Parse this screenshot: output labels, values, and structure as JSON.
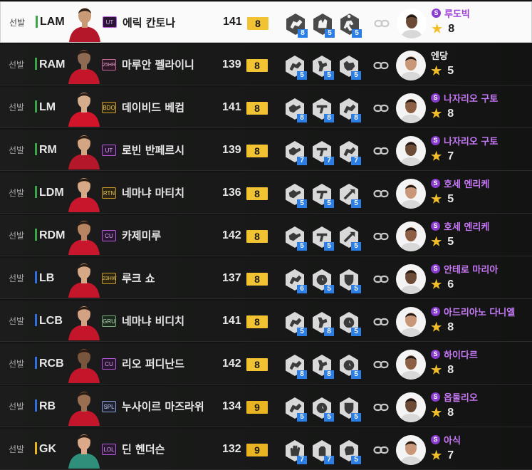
{
  "rows": [
    {
      "starter": "선발",
      "pos": "LAM",
      "pos_color": "#3aa64a",
      "badge": "UT",
      "badge_style": "",
      "name": "에릭 칸토나",
      "ovr": "141",
      "level": "8",
      "skills": [
        {
          "icon": "running-boot-icon",
          "v": "8"
        },
        {
          "icon": "hand-ball-icon",
          "v": "5"
        },
        {
          "icon": "player-run-icon",
          "v": "5"
        }
      ],
      "coach_special": true,
      "coach_name": "루도빅",
      "coach_star": "8",
      "selected": true,
      "kit": "#b5172a",
      "skin": "#c89a76"
    },
    {
      "starter": "선발",
      "pos": "RAM",
      "pos_color": "#3aa64a",
      "badge": "25HR",
      "badge_style": "pinkish",
      "name": "마루안 펠라이니",
      "ovr": "139",
      "level": "8",
      "skills": [
        {
          "icon": "running-boot-icon",
          "v": "5"
        },
        {
          "icon": "header-icon",
          "v": "5"
        },
        {
          "icon": "ball-control-icon",
          "v": "5"
        }
      ],
      "coach_special": false,
      "coach_name": "엔당",
      "coach_star": "5",
      "selected": false,
      "kit": "#c4162b",
      "skin": "#8e6a52"
    },
    {
      "starter": "선발",
      "pos": "LM",
      "pos_color": "#3aa64a",
      "badge": "BDO",
      "badge_style": "gold",
      "name": "데이비드 베컴",
      "ovr": "141",
      "level": "8",
      "skills": [
        {
          "icon": "pass-icon",
          "v": "8"
        },
        {
          "icon": "shot-icon",
          "v": "8"
        },
        {
          "icon": "running-boot-icon",
          "v": "8"
        }
      ],
      "coach_special": true,
      "coach_name": "나자리오 구토",
      "coach_star": "8",
      "selected": false,
      "kit": "#d2142b",
      "skin": "#d6ad8c"
    },
    {
      "starter": "선발",
      "pos": "RM",
      "pos_color": "#3aa64a",
      "badge": "UT",
      "badge_style": "",
      "name": "로빈 반페르시",
      "ovr": "139",
      "level": "8",
      "skills": [
        {
          "icon": "pass-icon",
          "v": "7"
        },
        {
          "icon": "shot-icon",
          "v": "7"
        },
        {
          "icon": "running-boot-icon",
          "v": "7"
        }
      ],
      "coach_special": true,
      "coach_name": "나자리오 구토",
      "coach_star": "7",
      "selected": false,
      "kit": "#b5172a",
      "skin": "#d3a582"
    },
    {
      "starter": "선발",
      "pos": "LDM",
      "pos_color": "#3aa64a",
      "badge": "RTN",
      "badge_style": "gold",
      "name": "네마냐 마티치",
      "ovr": "136",
      "level": "8",
      "skills": [
        {
          "icon": "pass-icon",
          "v": "5"
        },
        {
          "icon": "shot-icon",
          "v": "5"
        },
        {
          "icon": "long-pass-icon",
          "v": "5"
        }
      ],
      "coach_special": true,
      "coach_name": "호세 엔리케",
      "coach_star": "5",
      "selected": false,
      "kit": "#c8162c",
      "skin": "#d7a887"
    },
    {
      "starter": "선발",
      "pos": "RDM",
      "pos_color": "#3aa64a",
      "badge": "CU",
      "badge_style": "",
      "name": "카제미루",
      "ovr": "142",
      "level": "8",
      "skills": [
        {
          "icon": "pass-icon",
          "v": "5"
        },
        {
          "icon": "shot-icon",
          "v": "5"
        },
        {
          "icon": "long-pass-icon",
          "v": "5"
        }
      ],
      "coach_special": true,
      "coach_name": "호세 엔리케",
      "coach_star": "5",
      "selected": false,
      "kit": "#c8162c",
      "skin": "#b88462"
    },
    {
      "starter": "선발",
      "pos": "LB",
      "pos_color": "#2f6fe0",
      "badge": "23HW",
      "badge_style": "gold",
      "name": "루크 쇼",
      "ovr": "137",
      "level": "8",
      "skills": [
        {
          "icon": "running-boot-icon",
          "v": "6"
        },
        {
          "icon": "stopwatch-icon",
          "v": "5"
        },
        {
          "icon": "shield-icon",
          "v": "5"
        }
      ],
      "coach_special": true,
      "coach_name": "안테로 마리아",
      "coach_star": "6",
      "selected": false,
      "kit": "#c4162b",
      "skin": "#d6a886"
    },
    {
      "starter": "선발",
      "pos": "LCB",
      "pos_color": "#2f6fe0",
      "badge": "GRU",
      "badge_style": "green",
      "name": "네마냐 비디치",
      "ovr": "141",
      "level": "8",
      "skills": [
        {
          "icon": "running-boot-icon",
          "v": "5"
        },
        {
          "icon": "header-icon",
          "v": "8"
        },
        {
          "icon": "stopwatch-icon",
          "v": "5"
        }
      ],
      "coach_special": true,
      "coach_name": "아드리아노 다니엘",
      "coach_star": "8",
      "selected": false,
      "kit": "#c4162b",
      "skin": "#d3a282"
    },
    {
      "starter": "선발",
      "pos": "RCB",
      "pos_color": "#2f6fe0",
      "badge": "CU",
      "badge_style": "",
      "name": "리오 퍼디난드",
      "ovr": "142",
      "level": "8",
      "skills": [
        {
          "icon": "running-boot-icon",
          "v": "8"
        },
        {
          "icon": "header-icon",
          "v": "8"
        },
        {
          "icon": "stopwatch-icon",
          "v": "5"
        }
      ],
      "coach_special": true,
      "coach_name": "하이다르",
      "coach_star": "8",
      "selected": false,
      "kit": "#c4162b",
      "skin": "#7a553d"
    },
    {
      "starter": "선발",
      "pos": "RB",
      "pos_color": "#2f6fe0",
      "badge": "SPL",
      "badge_style": "blue",
      "name": "누사이르 마즈라위",
      "ovr": "134",
      "level": "9",
      "skills": [
        {
          "icon": "running-boot-icon",
          "v": "5"
        },
        {
          "icon": "stopwatch-icon",
          "v": "5"
        },
        {
          "icon": "shield-icon",
          "v": "5"
        }
      ],
      "coach_special": true,
      "coach_name": "옵둘리오",
      "coach_star": "8",
      "selected": false,
      "kit": "#c4162b",
      "skin": "#9a6e50"
    },
    {
      "starter": "선발",
      "pos": "GK",
      "pos_color": "#e8b422",
      "badge": "LOL",
      "badge_style": "",
      "name": "딘 헨더슨",
      "ovr": "132",
      "level": "9",
      "skills": [
        {
          "icon": "glove-icon",
          "v": "7"
        },
        {
          "icon": "gk-reach-icon",
          "v": "7"
        },
        {
          "icon": "fist-icon",
          "v": "5"
        }
      ],
      "coach_special": true,
      "coach_name": "아식",
      "coach_star": "7",
      "selected": false,
      "kit": "#2f8f7a",
      "skin": "#dba98a"
    }
  ]
}
